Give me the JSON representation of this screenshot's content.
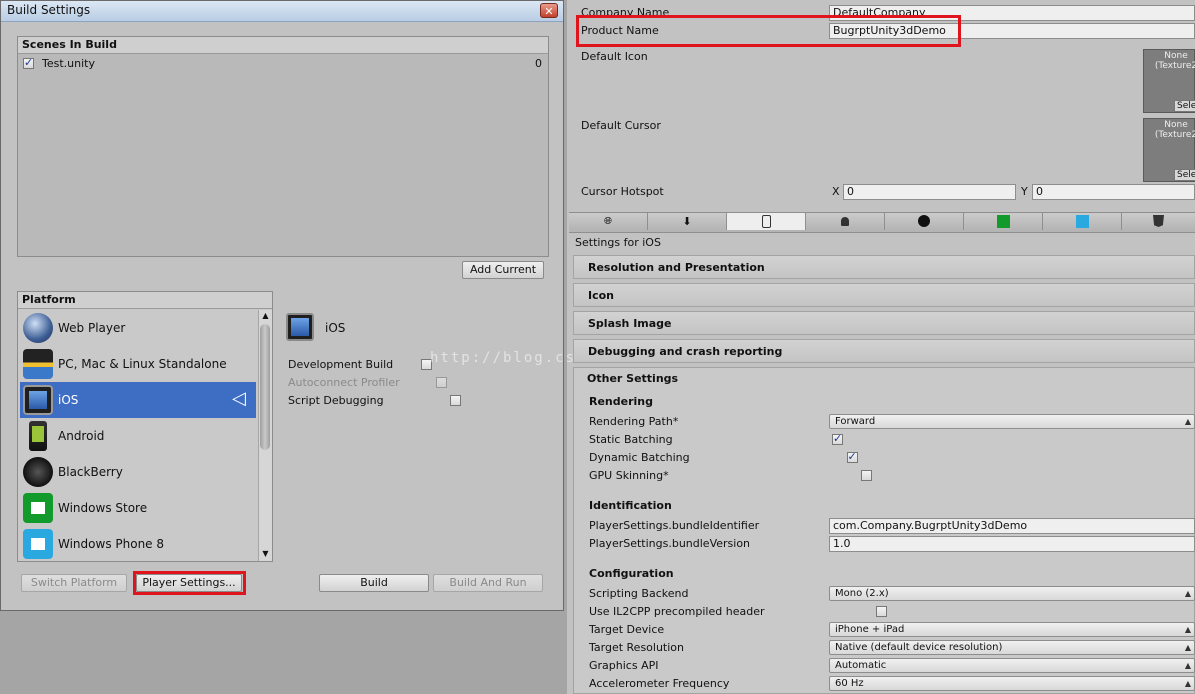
{
  "build_settings": {
    "title": "Build Settings",
    "close": "✕",
    "scenes_header": "Scenes In Build",
    "scenes": [
      {
        "name": "Test.unity",
        "index": "0",
        "checked": true
      }
    ],
    "add_current": "Add Current",
    "platform_header": "Platform",
    "platforms": [
      {
        "label": "Web Player",
        "icon": "globe-icon"
      },
      {
        "label": "PC, Mac & Linux Standalone",
        "icon": "penguin-icon"
      },
      {
        "label": "iOS",
        "icon": "ipad-icon"
      },
      {
        "label": "Android",
        "icon": "android-icon"
      },
      {
        "label": "BlackBerry",
        "icon": "blackberry-icon"
      },
      {
        "label": "Windows Store",
        "icon": "windows-store-icon"
      },
      {
        "label": "Windows Phone 8",
        "icon": "windows-phone-icon"
      }
    ],
    "selected_platform": "iOS",
    "detail_title": "iOS",
    "options": [
      {
        "label": "Development Build",
        "checked": false,
        "enabled": true
      },
      {
        "label": "Autoconnect Profiler",
        "checked": false,
        "enabled": false
      },
      {
        "label": "Script Debugging",
        "checked": false,
        "enabled": true
      }
    ],
    "switch_platform": "Switch Platform",
    "player_settings": "Player Settings...",
    "build": "Build",
    "build_and_run": "Build And Run"
  },
  "player_settings": {
    "company_label": "Company Name",
    "company_value": "DefaultCompany",
    "product_label": "Product Name",
    "product_value": "BugrptUnity3dDemo",
    "default_icon": "Default Icon",
    "default_cursor": "Default Cursor",
    "texture_none": "None",
    "texture_type": "(Texture2",
    "texture_select": "Sele",
    "cursor_hotspot": "Cursor Hotspot",
    "hotspot_x_label": "X",
    "hotspot_x": "0",
    "hotspot_y_label": "Y",
    "hotspot_y": "0",
    "tab_icons": [
      "globe-icon",
      "download-icon",
      "phone-icon",
      "android-icon",
      "blackberry-icon",
      "windows-store-icon",
      "windows-phone-icon",
      "html5-icon"
    ],
    "settings_for": "Settings for iOS",
    "sections": [
      "Resolution and Presentation",
      "Icon",
      "Splash Image",
      "Debugging and crash reporting"
    ],
    "other_settings": "Other Settings",
    "rendering_header": "Rendering",
    "rendering_path_label": "Rendering Path*",
    "rendering_path_value": "Forward",
    "static_batching": "Static Batching",
    "dynamic_batching": "Dynamic Batching",
    "gpu_skinning": "GPU Skinning*",
    "identification_header": "Identification",
    "bundle_id_label": "PlayerSettings.bundleIdentifier",
    "bundle_id_value": "com.Company.BugrptUnity3dDemo",
    "bundle_version_label": "PlayerSettings.bundleVersion",
    "bundle_version_value": "1.0",
    "configuration_header": "Configuration",
    "scripting_backend_label": "Scripting Backend",
    "scripting_backend_value": "Mono (2.x)",
    "il2cpp_label": "Use IL2CPP precompiled header",
    "target_device_label": "Target Device",
    "target_device_value": "iPhone + iPad",
    "target_resolution_label": "Target Resolution",
    "target_resolution_value": "Native (default device resolution)",
    "graphics_api_label": "Graphics API",
    "graphics_api_value": "Automatic",
    "accel_label": "Accelerometer Frequency",
    "accel_value": "60 Hz"
  },
  "watermark": "http://blog.cs",
  "colors": {
    "highlight": "#e0141c",
    "selection": "#3e6dc4"
  }
}
